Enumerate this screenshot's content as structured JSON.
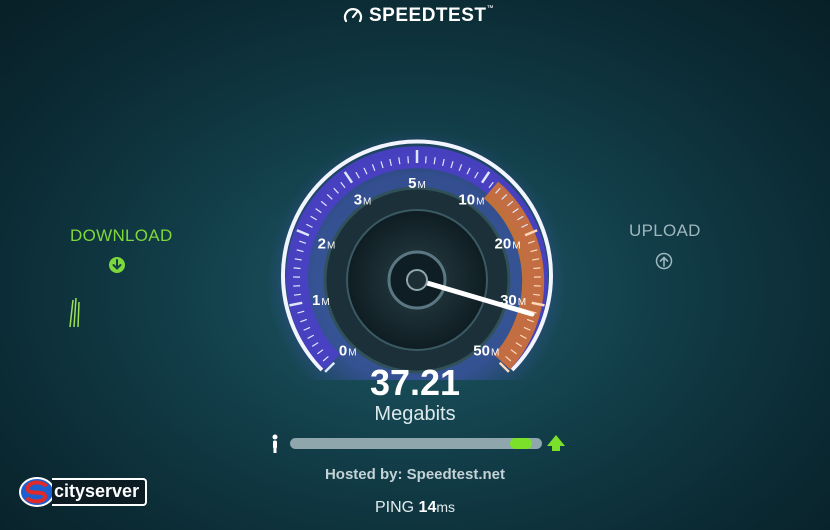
{
  "app": {
    "title": "SPEEDTEST",
    "trademark": "™"
  },
  "download": {
    "label": "DOWNLOAD",
    "icon": "download-arrow-icon",
    "color": "#7ed83b"
  },
  "upload": {
    "label": "UPLOAD",
    "icon": "upload-arrow-icon",
    "color": "#9fb6bd"
  },
  "gauge": {
    "ticks": [
      {
        "num": "0",
        "unit": "M"
      },
      {
        "num": "1",
        "unit": "M"
      },
      {
        "num": "2",
        "unit": "M"
      },
      {
        "num": "3",
        "unit": "M"
      },
      {
        "num": "5",
        "unit": "M"
      },
      {
        "num": "10",
        "unit": "M"
      },
      {
        "num": "20",
        "unit": "M"
      },
      {
        "num": "30",
        "unit": "M"
      },
      {
        "num": "50",
        "unit": "M"
      }
    ],
    "needle_value_mbps": 37.21,
    "arc_color": "#5b4fd6",
    "highlight_color": "#e07a2e"
  },
  "result": {
    "value": "37.21",
    "unit": "Megabits"
  },
  "progress": {
    "fraction": 0.97,
    "fill_color": "#7be02a"
  },
  "server": {
    "hosted_prefix": "Hosted by:",
    "host": "Speedtest.net"
  },
  "ping": {
    "label": "PING",
    "value": "14",
    "unit": "ms"
  },
  "watermark": {
    "brand": "cityserver"
  }
}
